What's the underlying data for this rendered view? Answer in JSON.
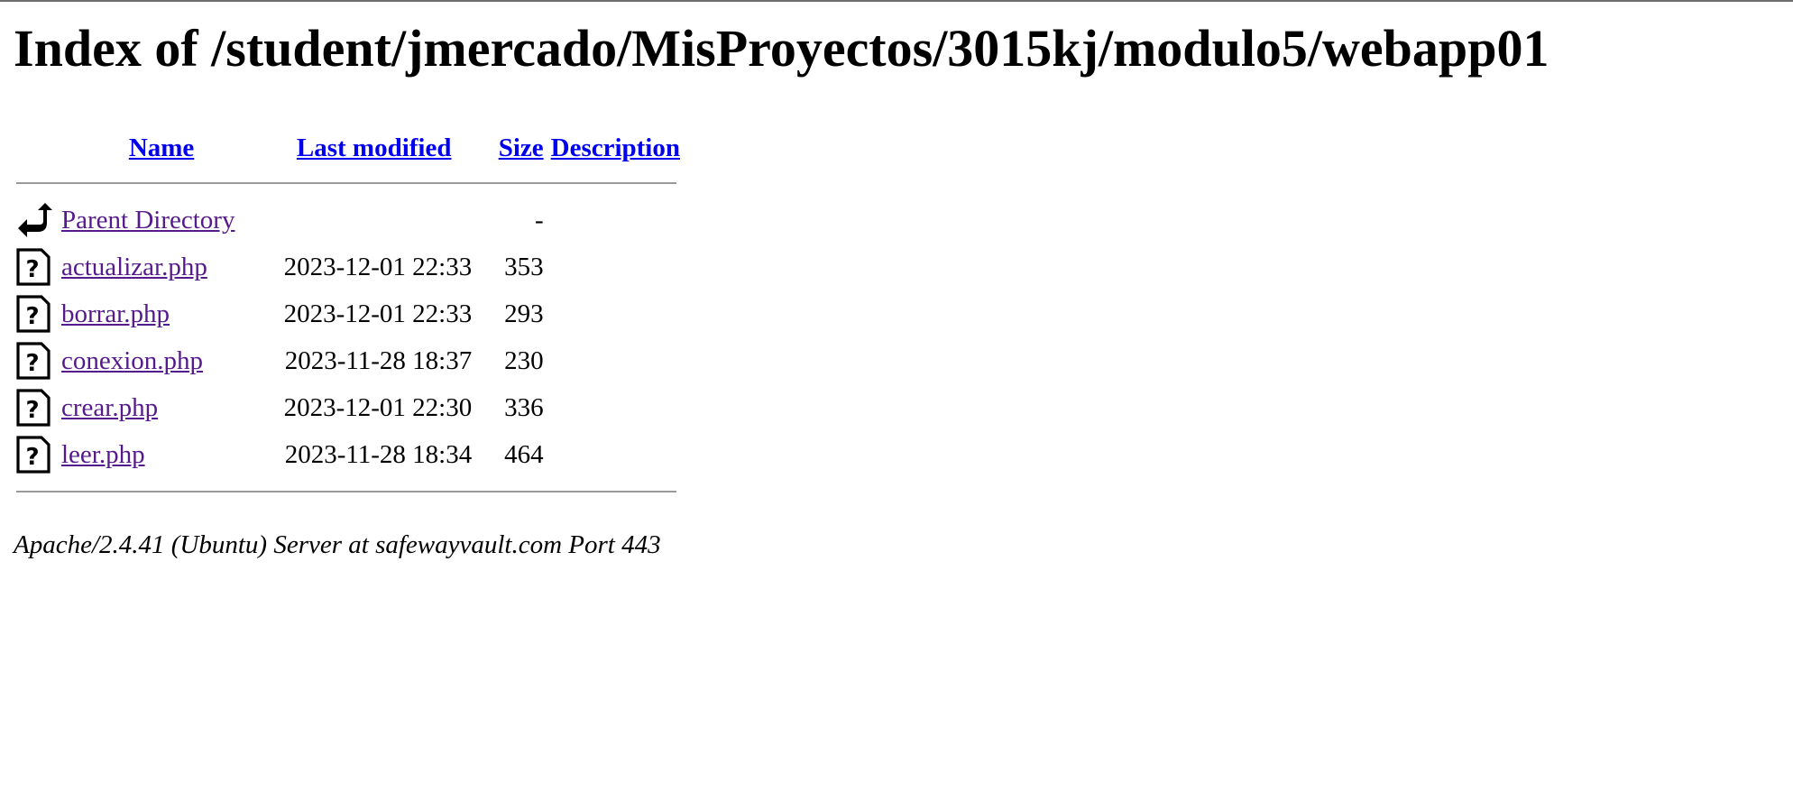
{
  "page": {
    "title": "Index of /student/jmercado/MisProyectos/3015kj/modulo5/webapp01"
  },
  "table": {
    "headers": {
      "name": "Name",
      "last_modified": "Last modified",
      "size": "Size",
      "description": "Description"
    },
    "parent": {
      "icon": "back-arrow-icon",
      "label": "Parent Directory",
      "size": "-"
    },
    "rows": [
      {
        "icon": "unknown-file-icon",
        "name": "actualizar.php",
        "modified": "2023-12-01 22:33",
        "size": "353"
      },
      {
        "icon": "unknown-file-icon",
        "name": "borrar.php",
        "modified": "2023-12-01 22:33",
        "size": "293"
      },
      {
        "icon": "unknown-file-icon",
        "name": "conexion.php",
        "modified": "2023-11-28 18:37",
        "size": "230"
      },
      {
        "icon": "unknown-file-icon",
        "name": "crear.php",
        "modified": "2023-12-01 22:30",
        "size": "336"
      },
      {
        "icon": "unknown-file-icon",
        "name": "leer.php",
        "modified": "2023-11-28 18:34",
        "size": "464"
      }
    ]
  },
  "footer": {
    "address": "Apache/2.4.41 (Ubuntu) Server at safewayvault.com Port 443"
  },
  "colors": {
    "link": "#0000ee",
    "visited": "#551a8b",
    "rule": "#9a9a9a"
  }
}
